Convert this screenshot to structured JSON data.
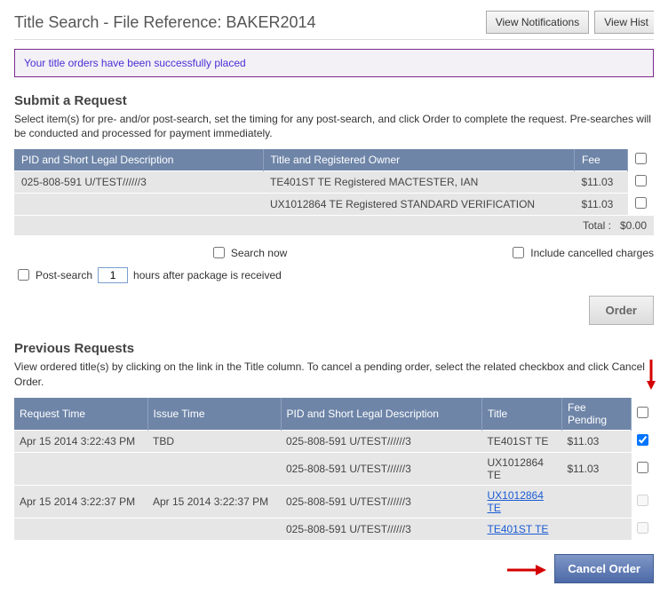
{
  "header": {
    "title": "Title Search - File Reference:  BAKER2014",
    "btn_notifications": "View Notifications",
    "btn_history": "View Hist"
  },
  "notice_text": "Your title orders have been successfully placed",
  "submit": {
    "heading": "Submit a Request",
    "instructions": "Select item(s) for pre- and/or post-search, set the timing for any post-search, and click Order to complete the request. Pre-searches will be conducted and processed for payment immediately.",
    "columns": {
      "pid": "PID and Short Legal Description",
      "title": "Title and Registered Owner",
      "fee": "Fee"
    },
    "rows": [
      {
        "pid": "025-808-591 U/TEST//////3",
        "title": "TE401ST TE Registered MACTESTER, IAN",
        "fee": "$11.03"
      },
      {
        "pid": "",
        "title": "UX1012864 TE Registered STANDARD VERIFICATION",
        "fee": "$11.03"
      }
    ],
    "total_label": "Total :",
    "total_value": "$0.00",
    "search_now_label": "Search now",
    "include_cancelled_label": "Include cancelled charges",
    "post_search_label": "Post-search",
    "post_hours_value": "1",
    "post_hours_suffix": "hours after package is received",
    "order_btn_label": "Order"
  },
  "previous": {
    "heading": "Previous Requests",
    "instructions": "View ordered title(s) by clicking on the link in the Title column. To cancel a pending order, select the related checkbox and click Cancel Order.",
    "columns": {
      "request_time": "Request Time",
      "issue_time": "Issue Time",
      "pid": "PID and Short Legal Description",
      "title": "Title",
      "fee": "Fee Pending"
    },
    "rows": [
      {
        "request_time": "Apr 15 2014 3:22:43 PM",
        "issue_time": "TBD",
        "pid": "025-808-591 U/TEST//////3",
        "title": "TE401ST TE",
        "is_link": false,
        "fee": "$11.03",
        "checked": true
      },
      {
        "request_time": "",
        "issue_time": "",
        "pid": "025-808-591 U/TEST//////3",
        "title": "UX1012864 TE",
        "is_link": false,
        "fee": "$11.03",
        "checked": false
      },
      {
        "request_time": "Apr 15 2014 3:22:37 PM",
        "issue_time": "Apr 15 2014 3:22:37 PM",
        "pid": "025-808-591 U/TEST//////3",
        "title": "UX1012864 TE",
        "is_link": true,
        "fee": "",
        "checked": false,
        "disabled": true
      },
      {
        "request_time": "",
        "issue_time": "",
        "pid": "025-808-591 U/TEST//////3",
        "title": "TE401ST TE",
        "is_link": true,
        "fee": "",
        "checked": false,
        "disabled": true
      }
    ],
    "cancel_btn_label": "Cancel Order"
  }
}
